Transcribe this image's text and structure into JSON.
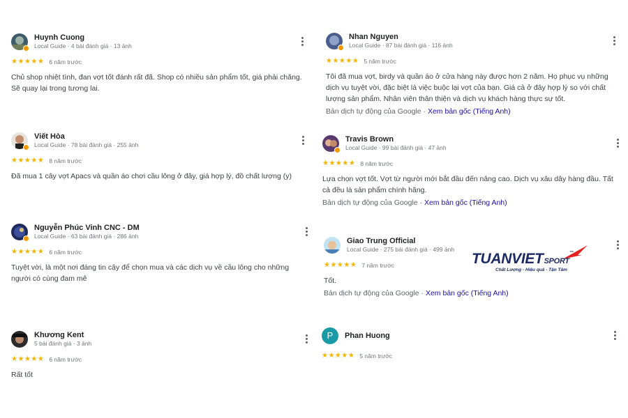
{
  "reviews": [
    {
      "name": "Huynh Cuong",
      "meta": "Local Guide · 4 bài đánh giá · 13 ảnh",
      "stars": "★★★★★",
      "time": "6 năm trước",
      "text": "Chủ shop nhiệt tình, đan vợt tốt đánh rất đã. Shop có nhiều sản phẩm tốt, giá phải chăng. Sẽ quay lại trong tương lai.",
      "translation": "",
      "translation_link": ""
    },
    {
      "name": "Nhan Nguyen",
      "meta": "Local Guide · 87 bài đánh giá · 116 ảnh",
      "stars": "★★★★★",
      "time": "5 năm trước",
      "text": "Tôi đã mua vợt, birdy và quần áo ở cửa hàng này được hơn 2 năm. Họ phục vụ những dịch vụ tuyệt vời, đặc biệt là việc buộc lại vợt của bạn. Giá cả ở đây hợp lý so với chất lượng sản phẩm. Nhân viên thân thiện và dịch vụ khách hàng thực sự tốt.",
      "translation": "Bản dịch tự động của Google · ",
      "translation_link": "Xem bản gốc (Tiếng Anh)"
    },
    {
      "name": "Viết Hòa",
      "meta": "Local Guide · 78 bài đánh giá · 255 ảnh",
      "stars": "★★★★★",
      "time": "8 năm trước",
      "text": "Đã mua 1 cây vợt Apacs và quần áo chơi cầu lông ở đây, giá hợp lý, đồ chất lượng (y)",
      "translation": "",
      "translation_link": ""
    },
    {
      "name": "Travis Brown",
      "meta": "Local Guide · 99 bài đánh giá · 47 ảnh",
      "stars": "★★★★★",
      "time": "8 năm trước",
      "text": "Lựa chọn vợt tốt. Vợt từ người mới bắt đầu đến nâng cao. Dịch vụ xâu dây hàng đầu. Tất cả đều là sản phẩm chính hãng.",
      "translation": "Bản dịch tự động của Google · ",
      "translation_link": "Xem bản gốc (Tiếng Anh)"
    },
    {
      "name": "Nguyễn Phúc Vinh CNC - DM",
      "meta": "Local Guide · 63 bài đánh giá · 286 ảnh",
      "stars": "★★★★★",
      "time": "6 năm trước",
      "text": "Tuyệt vời, là một nơi đáng tin cậy để chọn mua và các dịch vụ về cầu lông cho những người có cùng đam mê",
      "translation": "",
      "translation_link": ""
    },
    {
      "name": "Giao Trung Official",
      "meta": "Local Guide · 275 bài đánh giá · 499 ảnh",
      "stars": "★★★★★",
      "time": "7 năm trước",
      "text": "Tốt.",
      "translation": "Bản dịch tự động của Google · ",
      "translation_link": "Xem bản gốc (Tiếng Anh)"
    },
    {
      "name": "Khương Kent",
      "meta": "5 bài đánh giá · 3 ảnh",
      "stars": "★★★★★",
      "time": "6 năm trước",
      "text": "Rất tốt",
      "translation": "",
      "translation_link": ""
    },
    {
      "name": "Phan Huong",
      "meta": "",
      "stars": "★★★★★",
      "time": "5 năm trước",
      "text": "",
      "translation": "",
      "translation_link": "",
      "avatar_letter": "P"
    }
  ],
  "logo": {
    "brand": "TUANVIET",
    "sport": "SPORT",
    "tm": "™",
    "slogan": "Chất Lượng - Hiệu quả - Tận Tâm"
  },
  "colors": {
    "star": "#f4b400",
    "link": "#1a0dab",
    "brand": "#1b2a63",
    "brand_accent": "#e52421",
    "avatar_p": "#1a9aa6"
  }
}
